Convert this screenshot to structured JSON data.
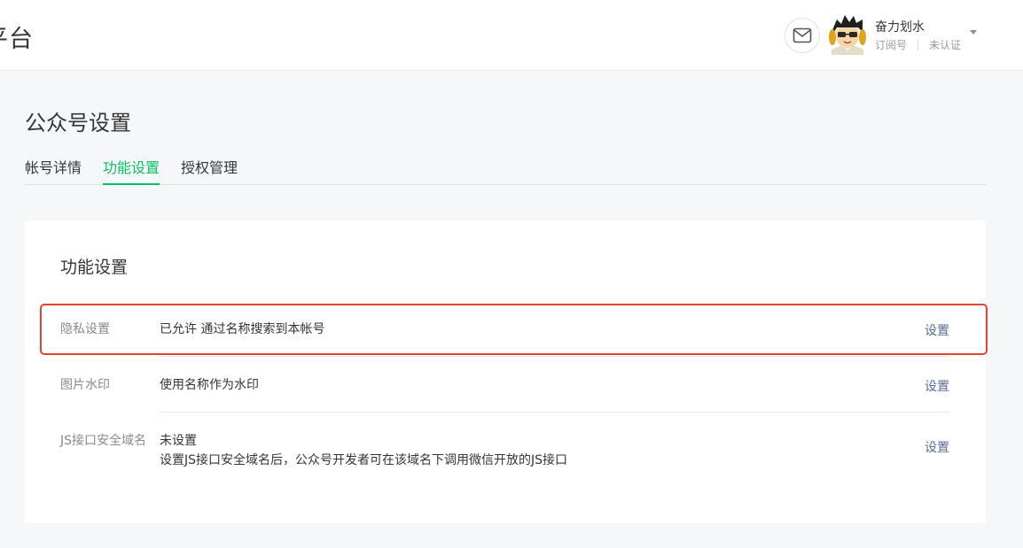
{
  "header": {
    "brand": "平台",
    "user_name": "奋力划水",
    "account_type": "订阅号",
    "verify_status": "未认证"
  },
  "page": {
    "title": "公众号设置",
    "tabs": [
      {
        "label": "帐号详情"
      },
      {
        "label": "功能设置"
      },
      {
        "label": "授权管理"
      }
    ],
    "active_tab": "功能设置"
  },
  "card": {
    "title": "功能设置",
    "rows": [
      {
        "label": "隐私设置",
        "value": "已允许 通过名称搜索到本帐号",
        "action": "设置"
      },
      {
        "label": "图片水印",
        "value": "使用名称作为水印",
        "action": "设置"
      },
      {
        "label": "JS接口安全域名",
        "value": "未设置",
        "note": "设置JS接口安全域名后，公众号开发者可在该域名下调用微信开放的JS接口",
        "action": "设置"
      }
    ]
  },
  "colors": {
    "accent": "#07c160",
    "link": "#576b95",
    "highlight": "#e8402f"
  },
  "icons": [
    "mail-icon",
    "user-avatar",
    "caret-down-icon"
  ]
}
